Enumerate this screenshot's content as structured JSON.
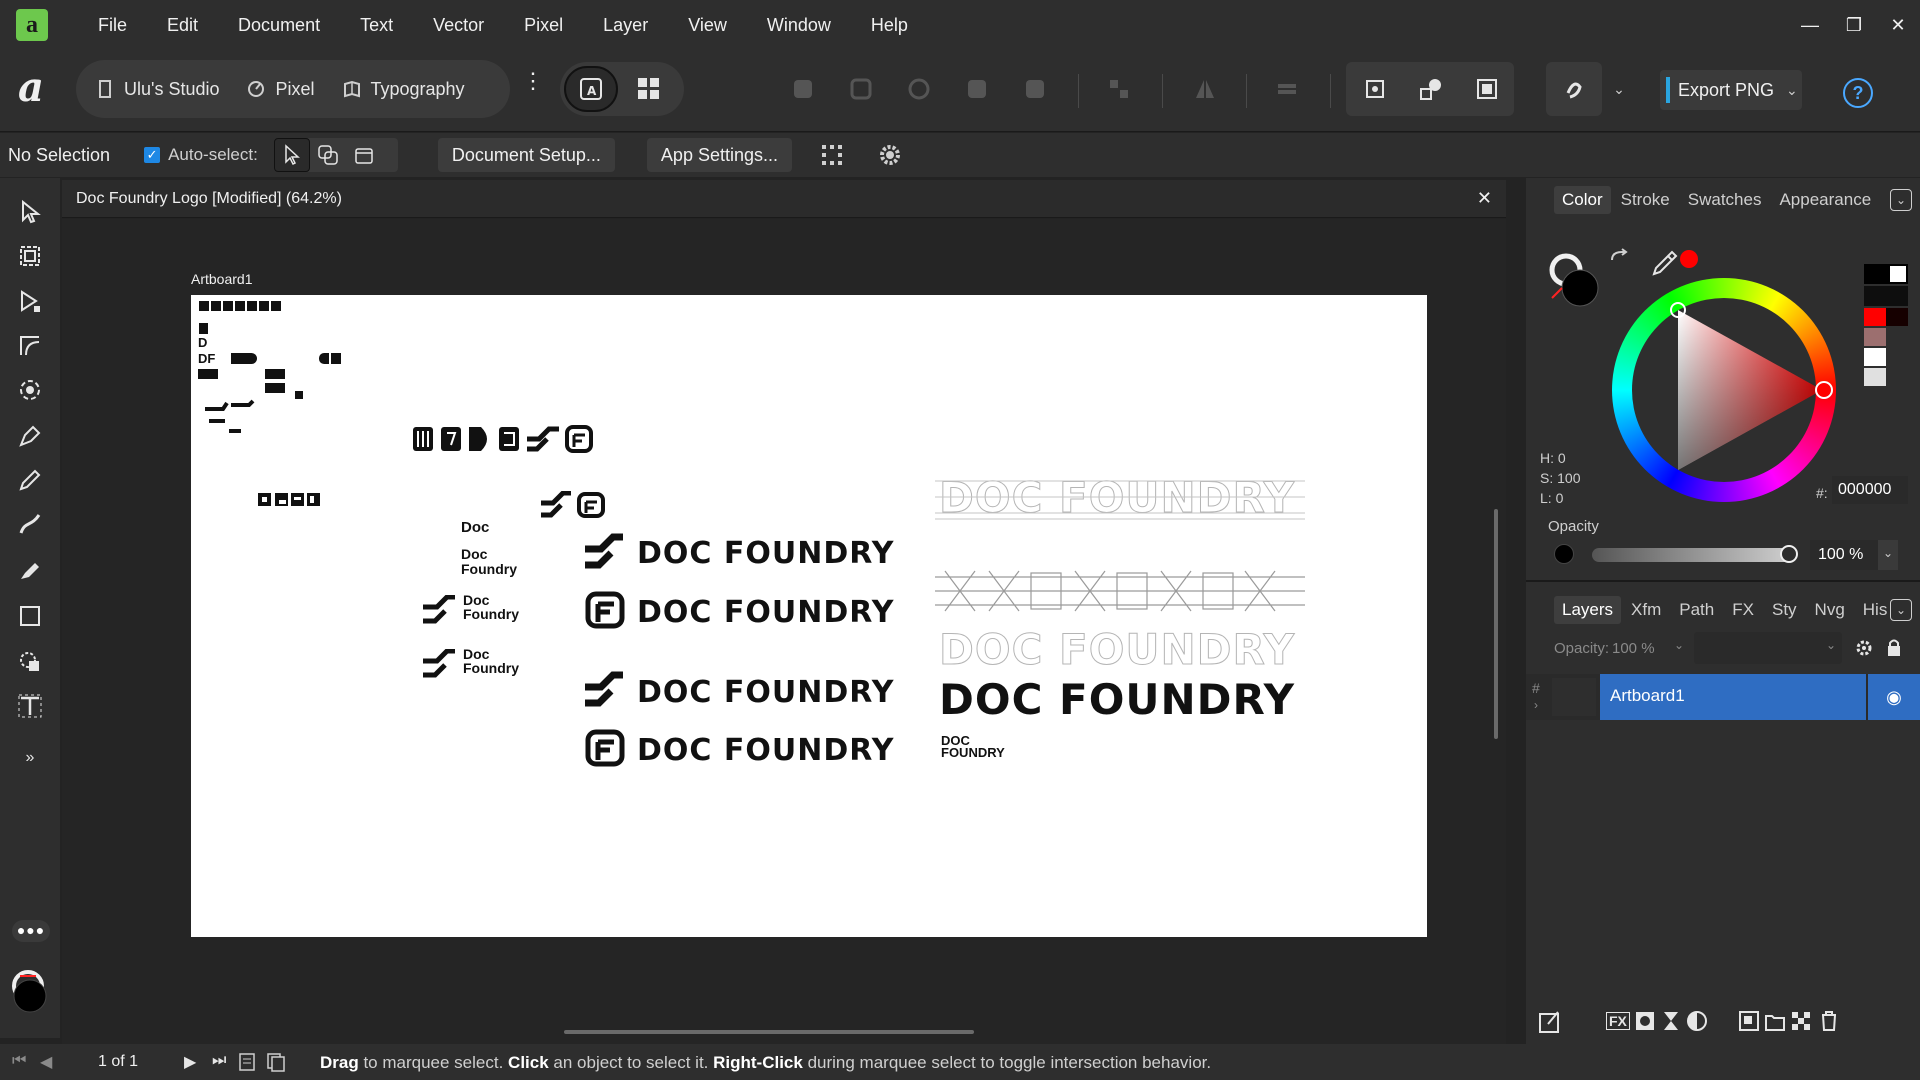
{
  "menu": {
    "items": [
      "File",
      "Edit",
      "Document",
      "Text",
      "Vector",
      "Pixel",
      "Layer",
      "View",
      "Window",
      "Help"
    ]
  },
  "toolbar": {
    "personas": [
      "Ulu's Studio",
      "Pixel",
      "Typography"
    ],
    "export_label": "Export PNG"
  },
  "context": {
    "selection": "No Selection",
    "autoselect_label": "Auto-select:",
    "document_setup": "Document Setup...",
    "app_settings": "App Settings..."
  },
  "document": {
    "title": "Doc Foundry Logo [Modified] (64.2%)",
    "artboard_label": "Artboard1",
    "wordmark": "DOC FOUNDRY",
    "doc_label": "Doc",
    "foundry_label": "Foundry",
    "tiny_doc": "DOC",
    "tiny_foundry": "FOUNDRY",
    "tiny_df": "DF"
  },
  "color_panel": {
    "tabs": [
      "Color",
      "Stroke",
      "Swatches",
      "Appearance"
    ],
    "active_tab": "Color",
    "h": "H: 0",
    "s": "S: 100",
    "l": "L: 0",
    "hex_label": "#:",
    "hex_value": "000000",
    "opacity_label": "Opacity",
    "opacity_value": "100 %",
    "accent_color": "#ff0000"
  },
  "layers_panel": {
    "tabs": [
      "Layers",
      "Xfm",
      "Path",
      "FX",
      "Sty",
      "Nvg",
      "His"
    ],
    "active_tab": "Layers",
    "opacity_label": "Opacity:",
    "opacity_value": "100 %",
    "layer_name": "Artboard1",
    "selection_color": "#2f6dc2"
  },
  "status": {
    "page": "1 of 1",
    "hint_parts": [
      {
        "bold": "Drag",
        "text": " to marquee select. "
      },
      {
        "bold": "Click",
        "text": " an object to select it. "
      },
      {
        "bold": "Right-Click",
        "text": " during marquee select to toggle intersection behavior."
      }
    ]
  }
}
